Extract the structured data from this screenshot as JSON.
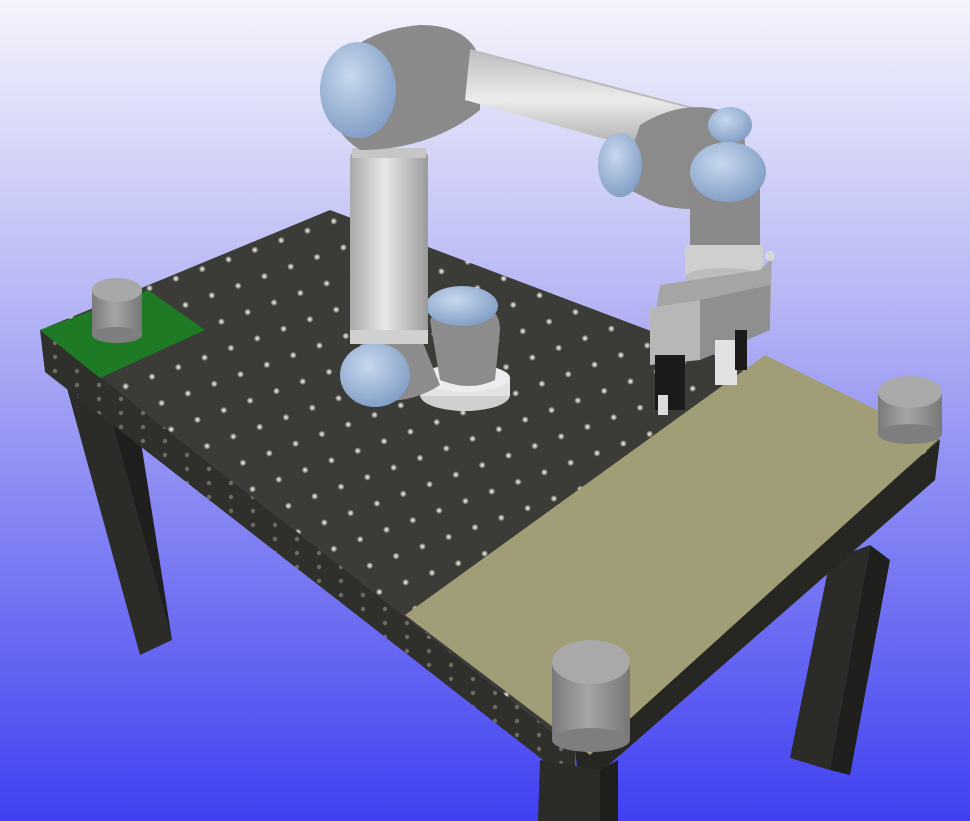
{
  "scene": {
    "colors": {
      "sky_top": "#f2f2fb",
      "sky_mid": "#a7a7f3",
      "sky_bottom": "#4545f2",
      "table_top": "#3b3b37",
      "table_side": "#2c2c29",
      "table_leg": "#2b2b28",
      "table_leg_shade": "#1f1f1d",
      "hole": "#8a8a80",
      "tan_pad": "#a19d76",
      "green_pad": "#1e7a25",
      "cylinder": "#8f8f8f",
      "cylinder_top": "#a8a8a8",
      "robot_gray": "#8e8e8e",
      "robot_light": "#d9d9d9",
      "robot_blue": "#9bb5d8",
      "gripper_black": "#1b1b1b"
    },
    "objects": [
      "perforated-table",
      "ur-robot-arm",
      "parallel-gripper",
      "tan-plate",
      "green-plate",
      "gray-cylinder"
    ]
  }
}
